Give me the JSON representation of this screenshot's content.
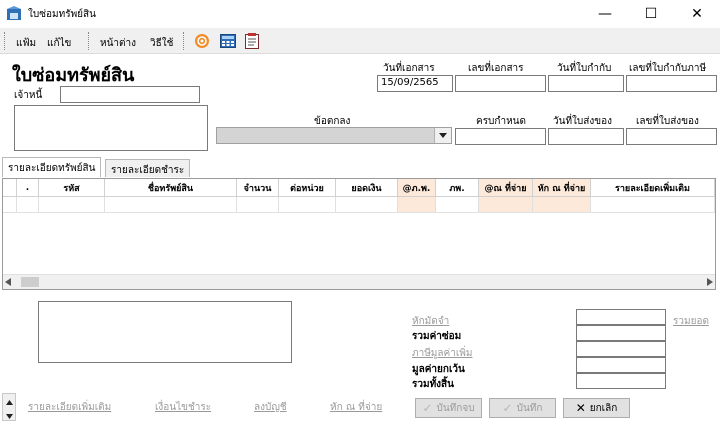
{
  "window": {
    "title": "ใบซ่อมทรัพย์สิน",
    "minimize_glyph": "—",
    "maximize_glyph": "☐",
    "close_glyph": "✕"
  },
  "menu": {
    "file": "แฟ้ม",
    "edit": "แก้ไข",
    "window": "หน้าต่าง",
    "help": "วิธีใช้"
  },
  "form": {
    "title": "ใบซ่อมทรัพย์สิน",
    "creditor_label": "เจ้าหนี้",
    "creditor_value": "",
    "doc_date_label": "วันที่เอกสาร",
    "doc_date_value": "15/09/2565",
    "doc_no_label": "เลขที่เอกสาร",
    "doc_no_value": "",
    "tax_date_label": "วันที่ใบกำกับ",
    "tax_date_value": "",
    "tax_no_label": "เลขที่ใบกำกับภาษี",
    "tax_no_value": "",
    "terms_label": "ข้อตกลง",
    "terms_value": "",
    "due_label": "ครบกำหนด",
    "due_value": "",
    "delivery_date_label": "วันที่ใบส่งของ",
    "delivery_date_value": "",
    "delivery_no_label": "เลขที่ใบส่งของ",
    "delivery_no_value": ""
  },
  "tabs": [
    {
      "label": "รายละเอียดทรัพย์สิน",
      "active": true
    },
    {
      "label": "รายละเอียดชำระ",
      "active": false
    }
  ],
  "grid": {
    "columns": [
      ".",
      "รหัส",
      "ชื่อทรัพย์สิน",
      "จำนวน",
      "ต่อหน่วย",
      "ยอดเงิน",
      "@ภ.พ.",
      "ภพ.",
      "@ณ ที่จ่าย",
      "หัก ณ ที่จ่าย",
      "รายละเอียดเพิ่มเติม"
    ]
  },
  "summary": {
    "discount_link": "หักมัดจำ",
    "repair_total": "รวมค่าซ่อม",
    "vat_link": "ภาษีมูลค่าเพิ่ม",
    "net_value": "มูลค่ายกเว้น",
    "grand_total": "รวมทั้งสิ้น",
    "total_link": "รวมยอด"
  },
  "footer": {
    "more_details": "รายละเอียดเพิ่มเติม",
    "payment_terms": "เงื่อนไขชำระ",
    "post_account": "ลงบัญชี",
    "withholding": "หัก ณ ที่จ่าย",
    "save_close": "บันทึกจบ",
    "save": "บันทึก",
    "cancel": "ยกเลิก"
  },
  "colors": {
    "peach_header": "#fde9d9",
    "menubar_bg": "#f0f0f0"
  }
}
